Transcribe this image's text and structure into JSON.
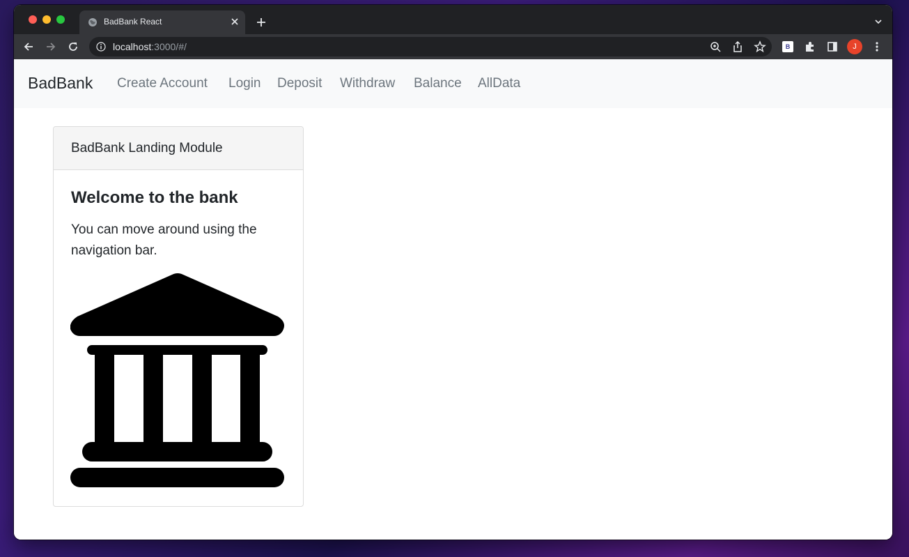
{
  "browser": {
    "tab_title": "BadBank React",
    "url_host": "localhost",
    "url_path": ":3000/#/",
    "extension_label": "B",
    "profile_initial": "J"
  },
  "navbar": {
    "brand": "BadBank",
    "links": [
      "Create Account",
      "Login",
      "Deposit",
      "Withdraw",
      "Balance",
      "AllData"
    ]
  },
  "card": {
    "header": "BadBank Landing Module",
    "title": "Welcome to the bank",
    "text": "You can move around using the navigation bar.",
    "image": "bank-icon"
  },
  "colors": {
    "navbar_bg": "#f8f9fa",
    "nav_link": "#6c757d",
    "brand": "#212529",
    "chrome_dark": "#202124",
    "chrome_toolbar": "#35363a"
  }
}
